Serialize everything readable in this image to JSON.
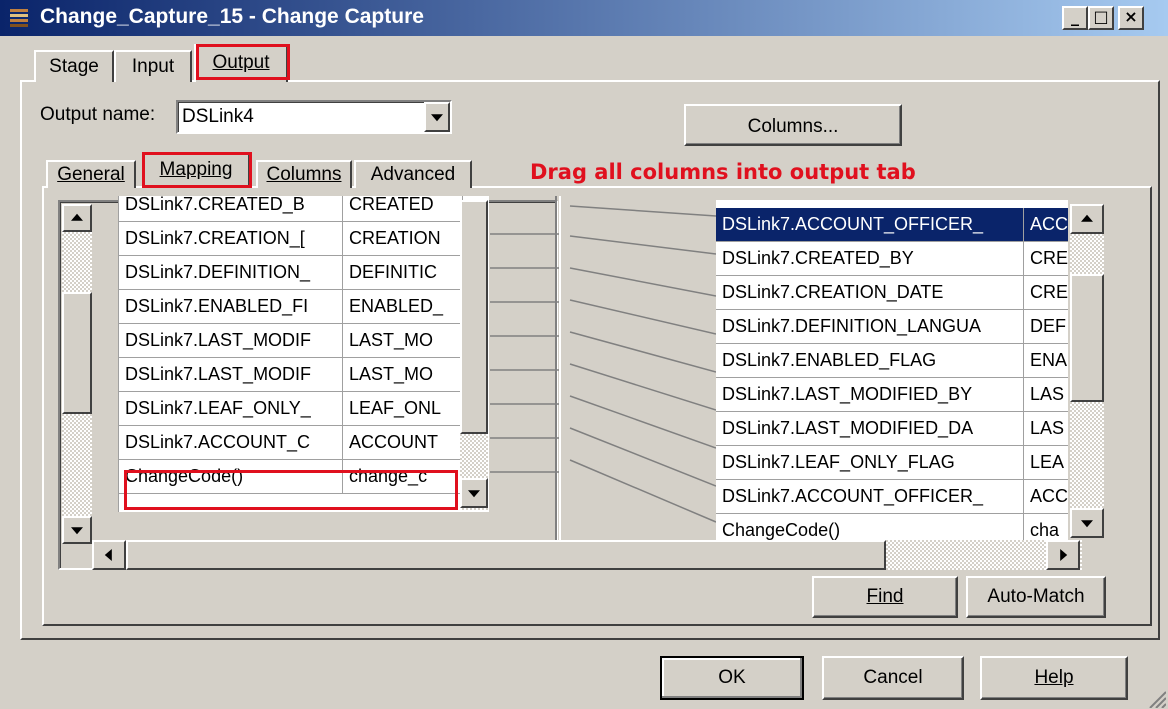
{
  "window": {
    "title": "Change_Capture_15 - Change Capture",
    "controls": [
      "_",
      "□",
      "×"
    ]
  },
  "top_tabs": [
    {
      "label": "Stage",
      "accel": ""
    },
    {
      "label": "Input",
      "accel": ""
    },
    {
      "label": "Output",
      "accel": "O"
    }
  ],
  "output_name": {
    "label": "Output name:",
    "value": "DSLink4"
  },
  "columns_button": "Columns...",
  "sub_tabs": [
    "General",
    "Mapping",
    "Columns",
    "Advanced"
  ],
  "annotation": "Drag all columns into output tab",
  "left_grid": {
    "rows": [
      [
        "DSLink7.CREATED_B",
        "CREATED"
      ],
      [
        "DSLink7.CREATION_[",
        "CREATION"
      ],
      [
        "DSLink7.DEFINITION_",
        "DEFINITIC"
      ],
      [
        "DSLink7.ENABLED_FI",
        "ENABLED_"
      ],
      [
        "DSLink7.LAST_MODIF",
        "LAST_MO"
      ],
      [
        "DSLink7.LAST_MODIF",
        "LAST_MO"
      ],
      [
        "DSLink7.LEAF_ONLY_",
        "LEAF_ONL"
      ],
      [
        "DSLink7.ACCOUNT_C",
        "ACCOUNT"
      ],
      [
        "ChangeCode()",
        "change_c"
      ]
    ]
  },
  "right_grid": {
    "rows": [
      [
        "DSLink7.ACCOUNT_OFFICER_",
        "ACC"
      ],
      [
        "DSLink7.CREATED_BY",
        "CRE"
      ],
      [
        "DSLink7.CREATION_DATE",
        "CRE"
      ],
      [
        "DSLink7.DEFINITION_LANGUA",
        "DEF"
      ],
      [
        "DSLink7.ENABLED_FLAG",
        "ENA"
      ],
      [
        "DSLink7.LAST_MODIFIED_BY",
        "LAS"
      ],
      [
        "DSLink7.LAST_MODIFIED_DA",
        "LAS"
      ],
      [
        "DSLink7.LEAF_ONLY_FLAG",
        "LEA"
      ],
      [
        "DSLink7.ACCOUNT_OFFICER_",
        "ACC"
      ],
      [
        "ChangeCode()",
        "cha"
      ]
    ]
  },
  "buttons": {
    "find": "Find",
    "auto_match": "Auto-Match",
    "ok": "OK",
    "cancel": "Cancel",
    "help": "Help"
  },
  "colors": {
    "accent_red": "#e0101e",
    "selection": "#0a246a",
    "titlebar": "#0a246a"
  }
}
